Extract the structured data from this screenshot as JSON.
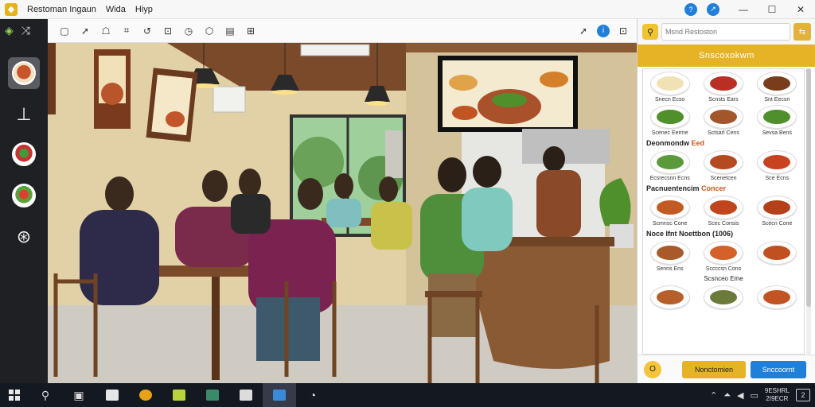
{
  "app": {
    "menu": [
      "Restoman Ingaun",
      "Wida",
      "Hiyp"
    ]
  },
  "window_controls": {
    "minimize": "—",
    "maximize": "☐",
    "close": "✕"
  },
  "title_buttons": {
    "help": "?",
    "share": "↗"
  },
  "left_toolbar": {
    "top_icons": [
      "diamond-icon",
      "shuffle-icon"
    ],
    "tools": [
      "dish-thumbnail",
      "shelf-icon",
      "dish-red",
      "dish-green",
      "map-pin-icon"
    ]
  },
  "canvas_toolbar": {
    "tools": [
      "▢",
      "➚",
      "☖",
      "⌗",
      "↺",
      "⊡",
      "◷",
      "⬡",
      "▤",
      "⊞"
    ],
    "right_icons": {
      "pointer": "➚",
      "info": "i",
      "settings": "⊡"
    }
  },
  "panel": {
    "search": {
      "placeholder": "Msnd Restoston"
    },
    "header": "Snscoxokwm",
    "sections": [
      {
        "title": "",
        "highlight": "",
        "items": [
          {
            "name": "Snecn Ecso",
            "color": "#f1e2b6"
          },
          {
            "name": "Scnsts Ears",
            "color": "#b92f24"
          },
          {
            "name": "Snt Eecsn",
            "color": "#7a3d1c"
          },
          {
            "name": "Scenec Eerme",
            "color": "#4f8f2c"
          },
          {
            "name": "Sctsarl Cens",
            "color": "#a3562c"
          },
          {
            "name": "Sevsa Bens",
            "color": "#4f8f2c"
          }
        ]
      },
      {
        "title": "Deonmondw ",
        "highlight": "Eed",
        "items": [
          {
            "name": "Ecsrecsnn Ecns",
            "color": "#5a9a3a"
          },
          {
            "name": "Scenetcen",
            "color": "#b54a20"
          },
          {
            "name": "Sce Ecns",
            "color": "#c9421f"
          }
        ]
      },
      {
        "title": "Pacnuentencim ",
        "highlight": "Concer",
        "items": [
          {
            "name": "Scmnsc Cone",
            "color": "#c25b22"
          },
          {
            "name": "Scec Consis",
            "color": "#c0441c"
          },
          {
            "name": "Scecn Cone",
            "color": "#b4401a"
          }
        ]
      },
      {
        "title": "Noce Ifnt Noettbon (1006)",
        "highlight": "",
        "items": [
          {
            "name": "Senns Ens",
            "color": "#a85a2a"
          },
          {
            "name": "Sccccsn Cons",
            "color": "#d4602a"
          },
          {
            "name": "",
            "color": "#c0501f"
          }
        ]
      },
      {
        "title": "",
        "highlight": "",
        "small_label": "Scsnceo Eme",
        "items": [
          {
            "name": "",
            "color": "#b5602a"
          },
          {
            "name": "",
            "color": "#6a7a3a"
          },
          {
            "name": "",
            "color": "#c25424"
          }
        ]
      }
    ],
    "footer": {
      "round_button": "O",
      "primary_button": "Nonctomien",
      "secondary_button": "Snccoornt"
    }
  },
  "taskbar": {
    "clock": {
      "time": "9ESHRL",
      "date": "2I9ECR"
    },
    "notification_count": "2"
  },
  "colors": {
    "accent_yellow": "#e5b325",
    "accent_blue": "#1f7fd9",
    "sidebar_dark": "#1e2024"
  }
}
